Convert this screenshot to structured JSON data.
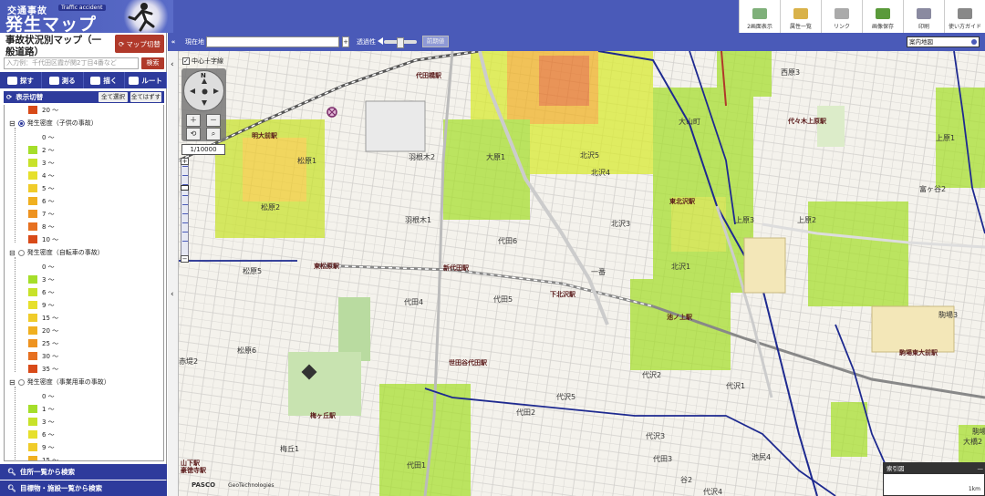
{
  "header": {
    "logo_small": "交通事故",
    "logo_tag": "Traffic accident",
    "logo_big": "発生マップ",
    "tools": [
      {
        "label": "2画面表示",
        "icon": "split-screen-icon",
        "color": "#7fb07a"
      },
      {
        "label": "属性一覧",
        "icon": "list-icon",
        "color": "#d9b24a"
      },
      {
        "label": "リンク",
        "icon": "link-icon",
        "color": "#aaaaaa"
      },
      {
        "label": "画像保存",
        "icon": "save-image-icon",
        "color": "#5a9a3a"
      },
      {
        "label": "印刷",
        "icon": "print-icon",
        "color": "#8a8aa0"
      },
      {
        "label": "使い方ガイド",
        "icon": "guide-icon",
        "color": "#888888"
      }
    ]
  },
  "left_panel": {
    "title": "事故状況別マップ（一般道路）",
    "map_switch_label": "マップ切替",
    "search_placeholder": "入力例：千代田区霞が関2丁目4番など",
    "search_button": "検索",
    "modes": [
      "探す",
      "測る",
      "描く",
      "ルート"
    ],
    "legend_header": "表示切替",
    "show_all": "全て選択",
    "hide_all": "全てはずす",
    "groups": [
      {
        "name": "発生密度（子供の事故）",
        "selected": true,
        "items": [
          {
            "label": "0 ～",
            "color": "#ffffff"
          },
          {
            "label": "2 ～",
            "color": "#a5de2a"
          },
          {
            "label": "3 ～",
            "color": "#c8e22a"
          },
          {
            "label": "4 ～",
            "color": "#e6e02c"
          },
          {
            "label": "5 ～",
            "color": "#f0cc2a"
          },
          {
            "label": "6 ～",
            "color": "#f0b020"
          },
          {
            "label": "7 ～",
            "color": "#ee9320"
          },
          {
            "label": "8 ～",
            "color": "#e67020"
          },
          {
            "label": "10 ～",
            "color": "#d84a18"
          }
        ]
      },
      {
        "name": "発生密度（自転車の事故）",
        "selected": false,
        "items": [
          {
            "label": "0 ～",
            "color": "#ffffff"
          },
          {
            "label": "3 ～",
            "color": "#a5de2a"
          },
          {
            "label": "6 ～",
            "color": "#c8e22a"
          },
          {
            "label": "9 ～",
            "color": "#e6e02c"
          },
          {
            "label": "15 ～",
            "color": "#f0cc2a"
          },
          {
            "label": "20 ～",
            "color": "#f0b020"
          },
          {
            "label": "25 ～",
            "color": "#ee9320"
          },
          {
            "label": "30 ～",
            "color": "#e67020"
          },
          {
            "label": "35 ～",
            "color": "#d84a18"
          }
        ]
      },
      {
        "name": "発生密度（事業用車の事故）",
        "selected": false,
        "items": [
          {
            "label": "0 ～",
            "color": "#ffffff"
          },
          {
            "label": "1 ～",
            "color": "#a5de2a"
          },
          {
            "label": "3 ～",
            "color": "#c8e22a"
          },
          {
            "label": "6 ～",
            "color": "#e6e02c"
          },
          {
            "label": "9 ～",
            "color": "#f0cc2a"
          },
          {
            "label": "15 ～",
            "color": "#f0b020"
          }
        ]
      }
    ],
    "top_partial": "20 ～",
    "bottom_buttons": [
      "住所一覧から検索",
      "目標物・施設一覧から検索"
    ]
  },
  "address_bar": {
    "current_label": "現在地",
    "transparency_label": "透過性",
    "prev_button": "前期値",
    "map_type": "案内地図"
  },
  "map": {
    "cross_label": "中心十字線",
    "scale": "1/10000",
    "minimap_title": "索引図",
    "minimap_scale": "1km",
    "credits": [
      "PASCO",
      "GeoTechnologies"
    ],
    "areas": [
      "代田橋駅",
      "西原3",
      "代々木上原駅",
      "上原1",
      "大原1",
      "羽根木2",
      "北沢5",
      "大山町",
      "松原1",
      "明大前駅",
      "北沢4",
      "富ヶ谷2",
      "松原2",
      "羽根木1",
      "代田6",
      "北沢3",
      "東北沢駅",
      "上原3",
      "上原2",
      "東松原駅",
      "新代田駅",
      "一番",
      "北沢1",
      "松原5",
      "代田4",
      "代田5",
      "下北沢駅",
      "池ノ上駅",
      "駒場3",
      "駒場東大前駅",
      "松原6",
      "赤堤2",
      "世田谷代田駅",
      "代沢2",
      "代沢1",
      "代田2",
      "代沢5",
      "代沢3",
      "駒場1",
      "梅ヶ丘駅",
      "代田3",
      "代田1",
      "池尻4",
      "梅丘1",
      "山下駅",
      "豪徳寺駅",
      "大橋2",
      "谷2",
      "代沢4"
    ]
  }
}
